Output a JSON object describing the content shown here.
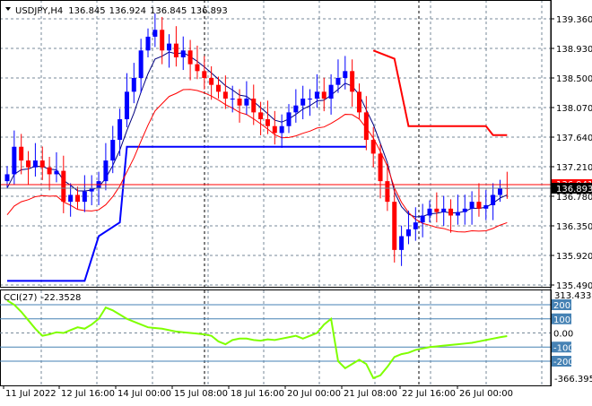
{
  "header": {
    "symbol": "USDJPY,H4",
    "open": "136.845",
    "high": "136.924",
    "low": "136.845",
    "close": "136.893"
  },
  "price_axis": {
    "ticks": [
      "139.360",
      "138.930",
      "138.500",
      "138.070",
      "137.640",
      "137.210",
      "136.780",
      "136.350",
      "135.920",
      "135.490"
    ],
    "current_price_label": "136.893",
    "red_line_label": "136.941"
  },
  "cci": {
    "label": "CCI(27)",
    "value": "-22.3528",
    "max_label": "313.4331",
    "min_label": "-366.3953",
    "levels": [
      "200",
      "100",
      "0.00",
      "-100",
      "-200"
    ]
  },
  "time_axis": [
    "11 Jul 2022",
    "12 Jul 16:00",
    "14 Jul 00:00",
    "15 Jul 08:00",
    "18 Jul 16:00",
    "20 Jul 00:00",
    "21 Jul 08:00",
    "22 Jul 16:00",
    "26 Jul 00:00"
  ],
  "colors": {
    "bull": "#0000ff",
    "bear": "#ff0000",
    "ma_fast": "#00007f",
    "ma_slow": "#ff0000",
    "cci": "#7fff00",
    "level": "#4682b4"
  },
  "chart_data": {
    "type": "candlestick",
    "ylim": [
      135.49,
      139.49
    ],
    "closes": [
      137.1,
      137.5,
      137.3,
      137.2,
      137.3,
      137.2,
      137.1,
      137.15,
      136.7,
      136.8,
      136.7,
      136.85,
      136.9,
      137.0,
      137.3,
      137.6,
      137.9,
      138.3,
      138.5,
      138.9,
      139.1,
      139.2,
      138.9,
      139.0,
      138.8,
      138.9,
      138.7,
      138.6,
      138.5,
      138.4,
      138.3,
      138.2,
      138.2,
      138.1,
      138.2,
      138.0,
      137.9,
      137.8,
      137.7,
      137.8,
      138.0,
      138.1,
      138.2,
      138.2,
      138.3,
      138.2,
      138.4,
      138.5,
      138.6,
      138.3,
      138.0,
      137.6,
      137.4,
      137.0,
      136.7,
      136.0,
      136.2,
      136.3,
      136.4,
      136.5,
      136.6,
      136.55,
      136.6,
      136.5,
      136.55,
      136.6,
      136.7,
      136.6,
      136.65,
      136.8,
      136.9,
      136.893
    ],
    "blue_stop": [
      [
        0,
        135.55
      ],
      [
        11,
        135.55
      ],
      [
        13,
        136.2
      ],
      [
        16,
        136.4
      ],
      [
        17,
        137.5
      ],
      [
        51,
        137.5
      ]
    ],
    "red_stop": [
      [
        52,
        138.9
      ],
      [
        55,
        138.78
      ],
      [
        57,
        137.8
      ],
      [
        68,
        137.8
      ],
      [
        69,
        137.67
      ],
      [
        71,
        137.67
      ]
    ],
    "cci_values": [
      230,
      200,
      150,
      90,
      30,
      -20,
      -10,
      5,
      0,
      20,
      40,
      30,
      60,
      100,
      180,
      160,
      130,
      100,
      80,
      60,
      40,
      35,
      30,
      20,
      10,
      5,
      0,
      -5,
      -10,
      -20,
      -60,
      -80,
      -50,
      -40,
      -40,
      -50,
      -55,
      -45,
      -50,
      -40,
      -30,
      -20,
      -40,
      -20,
      0,
      60,
      100,
      -200,
      -250,
      -220,
      -190,
      -220,
      -320,
      -300,
      -240,
      -170,
      -150,
      -140,
      -120,
      -110,
      -100,
      -95,
      -90,
      -85,
      -80,
      -75,
      -70,
      -60,
      -50,
      -40,
      -30,
      -22
    ]
  }
}
